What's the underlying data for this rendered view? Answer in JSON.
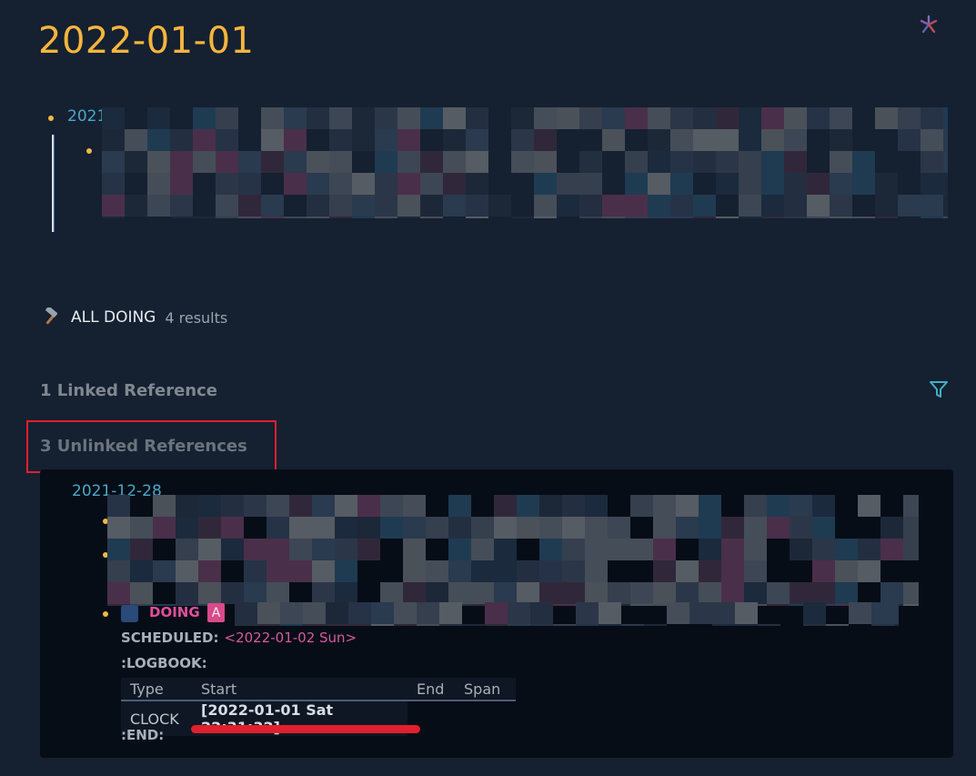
{
  "page": {
    "title": "2022-01-01"
  },
  "blocks": {
    "first_date_link": "2021-"
  },
  "query": {
    "label": "ALL DOING",
    "count": "4 results",
    "icon": "hammer-icon"
  },
  "references": {
    "linked_heading": "1 Linked Reference",
    "unlinked_heading": "3 Unlinked References",
    "filter_icon": "filter-icon",
    "card": {
      "date": "2021-12-28",
      "task": {
        "marker": "DOING",
        "priority": "A",
        "scheduled_label": "SCHEDULED:",
        "scheduled_value": "<2022-01-02 Sun>",
        "logbook_label": ":LOGBOOK:",
        "end_label": ":END:",
        "table": {
          "headers": [
            "Type",
            "Start",
            "End",
            "Span"
          ],
          "rows": [
            {
              "type": "CLOCK",
              "start": "[2022-01-01 Sat 22:31:32]",
              "end": "",
              "span": ""
            }
          ]
        }
      }
    }
  },
  "colors": {
    "background": "#152030",
    "title": "#f5b53d",
    "link": "#4aa7c8",
    "doing": "#e0509a",
    "annotation_red": "#e02030"
  }
}
